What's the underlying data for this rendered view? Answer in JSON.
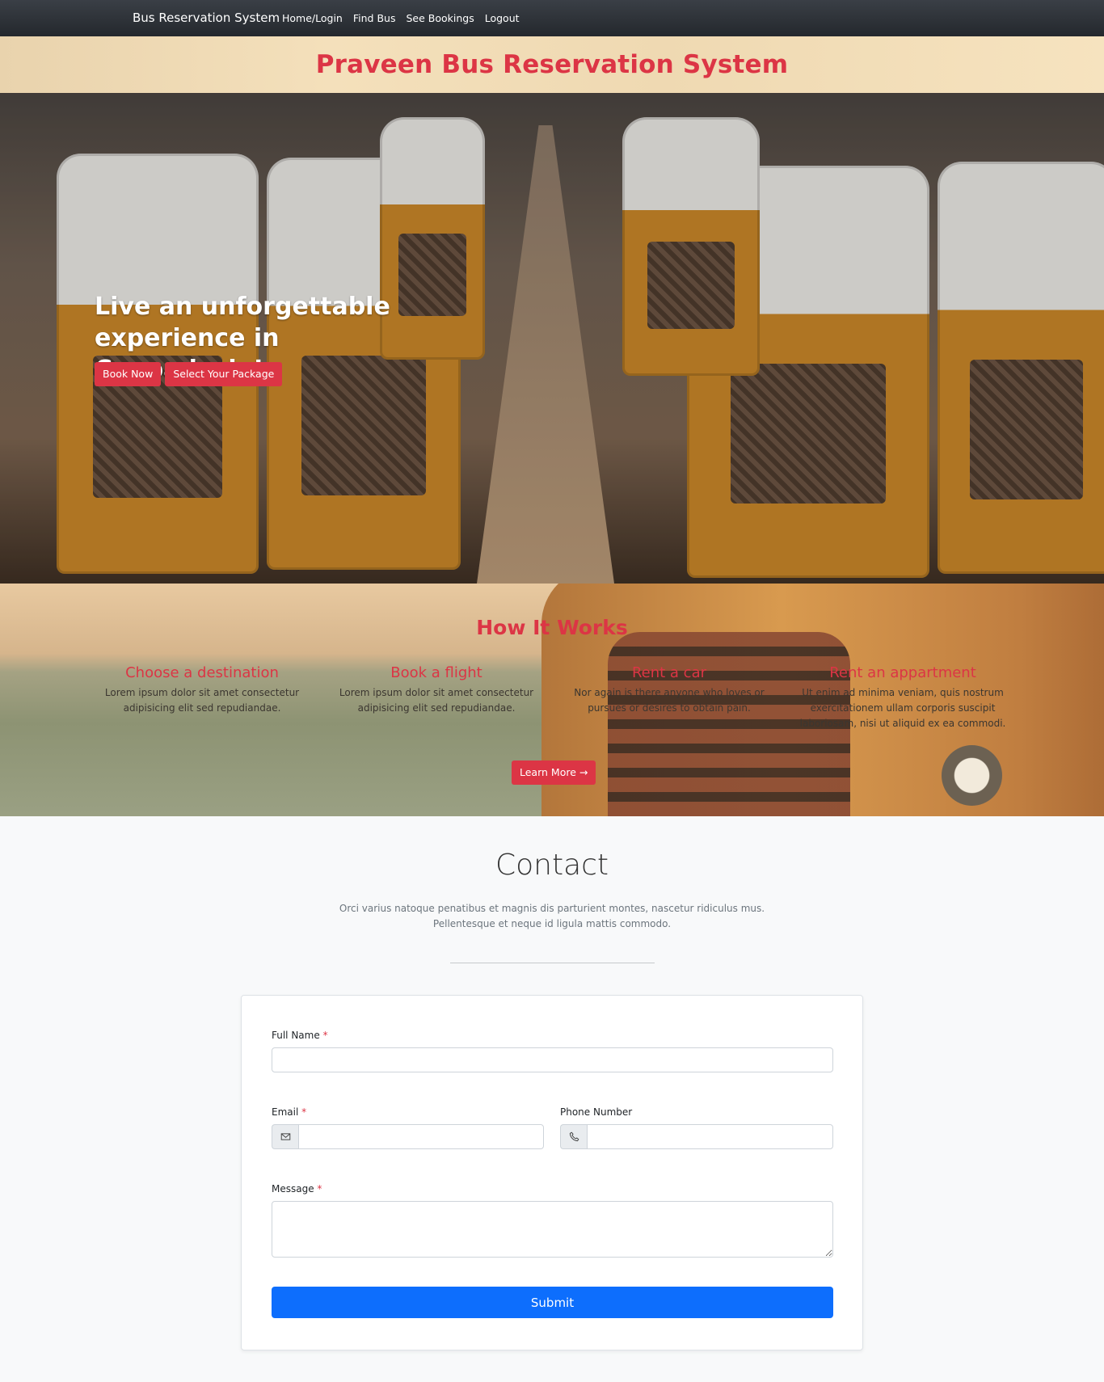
{
  "navbar": {
    "brand": "Bus Reservation System",
    "links": [
      "Home/Login",
      "Find Bus",
      "See Bookings",
      "Logout"
    ]
  },
  "header": {
    "title": "Praveen Bus Reservation System"
  },
  "hero": {
    "heading": "Live an unforgettable experience in Cappadocia!",
    "buttons": [
      "Book Now",
      "Select Your Package"
    ]
  },
  "how_it_works": {
    "title": "How It Works",
    "steps": [
      {
        "title": "Choose a destination",
        "text": "Lorem ipsum dolor sit amet consectetur adipisicing elit sed repudiandae."
      },
      {
        "title": "Book a flight",
        "text": "Lorem ipsum dolor sit amet consectetur adipisicing elit sed repudiandae."
      },
      {
        "title": "Rent a car",
        "text": "Nor again is there anyone who loves or pursues or desires to obtain pain."
      },
      {
        "title": "Rent an appartment",
        "text": "Ut enim ad minima veniam, quis nostrum exercitationem ullam corporis suscipit laboriosam, nisi ut aliquid ex ea commodi."
      }
    ],
    "button": "Learn More →"
  },
  "contact": {
    "title": "Contact",
    "subtitle_line1": "Orci varius natoque penatibus et magnis dis parturient montes, nascetur ridiculus mus.",
    "subtitle_line2": "Pellentesque et neque id ligula mattis commodo.",
    "form": {
      "full_name_label": "Full Name",
      "email_label": "Email",
      "phone_label": "Phone Number",
      "message_label": "Message",
      "required_mark": "*",
      "submit": "Submit",
      "email_icon": "envelope-icon",
      "phone_icon": "telephone-icon"
    }
  },
  "colors": {
    "accent_red": "#dc3545",
    "primary_blue": "#0d6efd",
    "navbar": "#2c3035"
  }
}
